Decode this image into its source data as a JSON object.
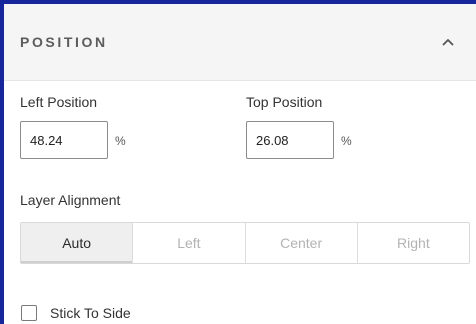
{
  "section": {
    "title": "POSITION",
    "collapse_icon": "chevron-up-icon"
  },
  "left_position": {
    "label": "Left Position",
    "value": "48.24",
    "unit": "%"
  },
  "top_position": {
    "label": "Top Position",
    "value": "26.08",
    "unit": "%"
  },
  "layer_alignment": {
    "label": "Layer Alignment",
    "options": [
      "Auto",
      "Left",
      "Center",
      "Right"
    ],
    "selected": "Auto"
  },
  "stick_to_side": {
    "label": "Stick To Side",
    "checked": false
  },
  "colors": {
    "frame_border": "#16279b",
    "header_bg": "#f5f5f5",
    "active_segment_bg": "#efefef"
  }
}
